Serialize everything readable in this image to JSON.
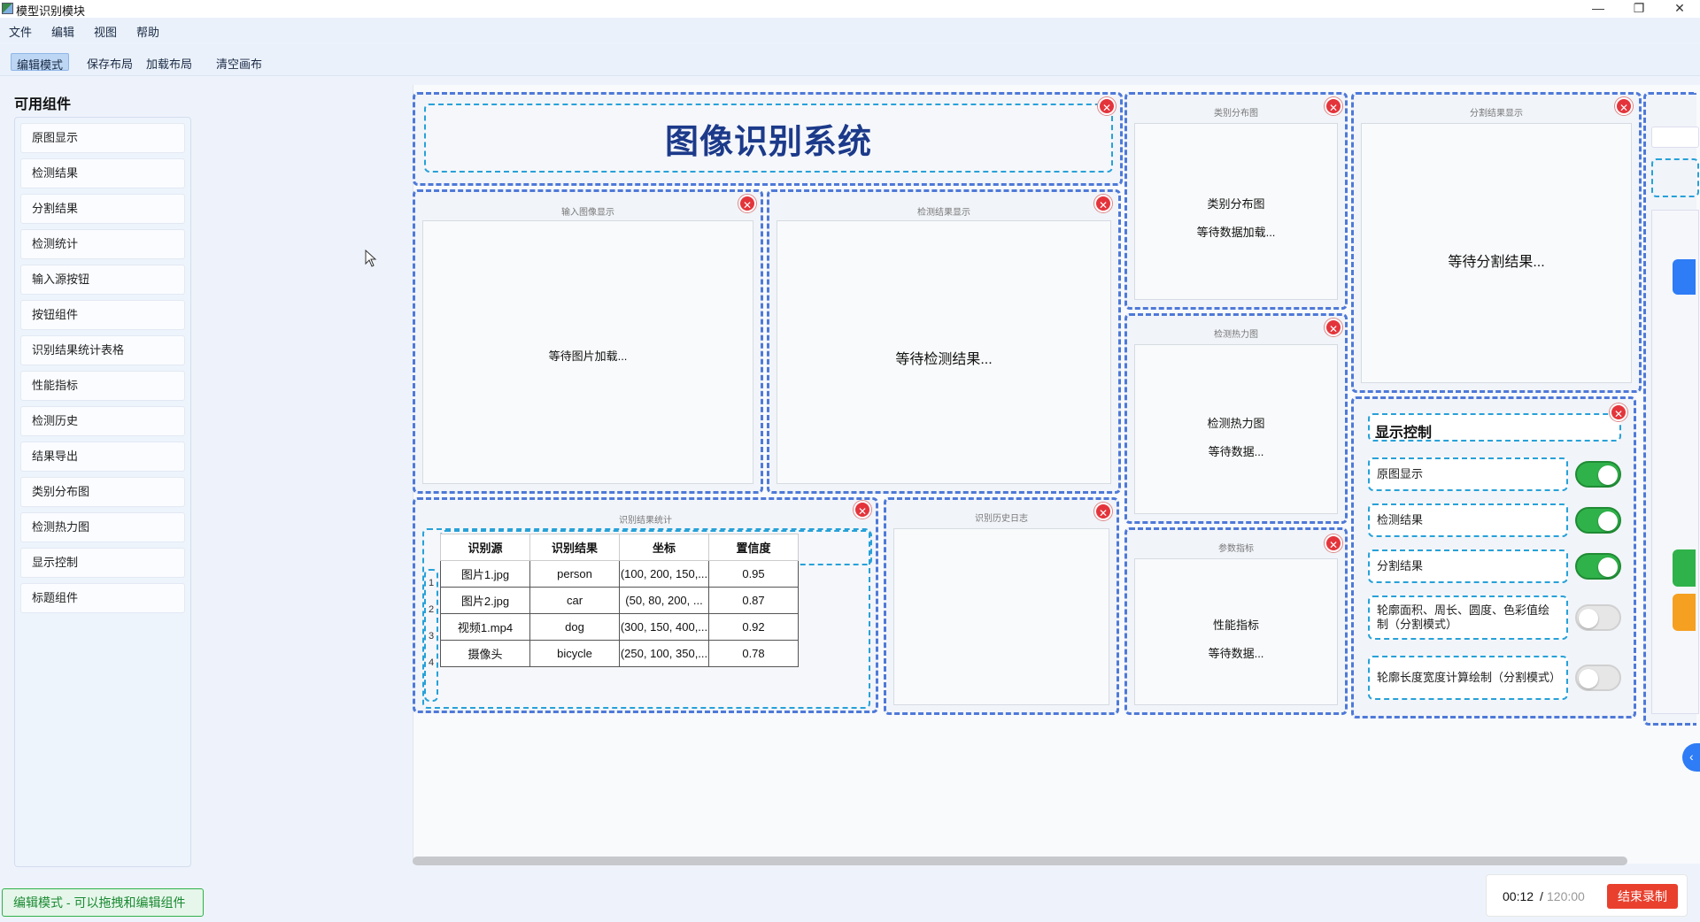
{
  "window": {
    "title": "模型识别模块",
    "min": "—",
    "restore": "❐",
    "close": "✕"
  },
  "menu": [
    "文件",
    "编辑",
    "视图",
    "帮助"
  ],
  "toolbar": [
    "编辑模式",
    "保存布局",
    "加载布局",
    "清空画布"
  ],
  "sidebar": {
    "title": "可用组件",
    "items": [
      "原图显示",
      "检测结果",
      "分割结果",
      "检测统计",
      "输入源按钮",
      "按钮组件",
      "识别结果统计表格",
      "性能指标",
      "检测历史",
      "结果导出",
      "类别分布图",
      "检测热力图",
      "显示控制",
      "标题组件"
    ]
  },
  "widgets": {
    "title": {
      "text": "图像识别系统"
    },
    "input_image": {
      "title": "输入图像显示",
      "text": "等待图片加载..."
    },
    "detect_result": {
      "title": "检测结果显示",
      "text": "等待检测结果..."
    },
    "category": {
      "title": "类别分布图",
      "line1": "类别分布图",
      "line2": "等待数据加载..."
    },
    "segment": {
      "title": "分割结果显示",
      "text": "等待分割结果..."
    },
    "heatmap": {
      "title": "检测热力图",
      "line1": "检测热力图",
      "line2": "等待数据..."
    },
    "params": {
      "title": "参数指标",
      "line1": "性能指标",
      "line2": "等待数据..."
    },
    "history": {
      "title": "识别历史日志"
    },
    "stats": {
      "title": "识别结果统计",
      "headers": [
        "识别源",
        "识别结果",
        "坐标",
        "置信度"
      ],
      "row_nums": [
        "1",
        "2",
        "3",
        "4"
      ],
      "rows": [
        [
          "图片1.jpg",
          "person",
          "(100, 200, 150,...",
          "0.95"
        ],
        [
          "图片2.jpg",
          "car",
          "(50, 80, 200, ...",
          "0.87"
        ],
        [
          "视频1.mp4",
          "dog",
          "(300, 150, 400,...",
          "0.92"
        ],
        [
          "摄像头",
          "bicycle",
          "(250, 100, 350,...",
          "0.78"
        ]
      ]
    },
    "display_control": {
      "title": "显示控制",
      "items": [
        {
          "label": "原图显示",
          "on": true
        },
        {
          "label": "检测结果",
          "on": true
        },
        {
          "label": "分割结果",
          "on": true
        },
        {
          "label": "轮廓面积、周长、圆度、色彩值绘制（分割模式）",
          "on": false
        },
        {
          "label": "轮廓长度宽度计算绘制（分割模式）",
          "on": false
        }
      ]
    },
    "close_glyph": "✕"
  },
  "status": {
    "mode_text": "编辑模式 - 可以拖拽和编辑组件"
  },
  "recorder": {
    "elapsed": "00:12",
    "sep": "/",
    "total": "120:00",
    "stop_label": "结束录制"
  },
  "colors": {
    "accent": "#4e79d8",
    "inner_dash": "#27a1d8",
    "toggle_on": "#2fb24a",
    "close": "#e4343b",
    "record": "#e9402e"
  }
}
